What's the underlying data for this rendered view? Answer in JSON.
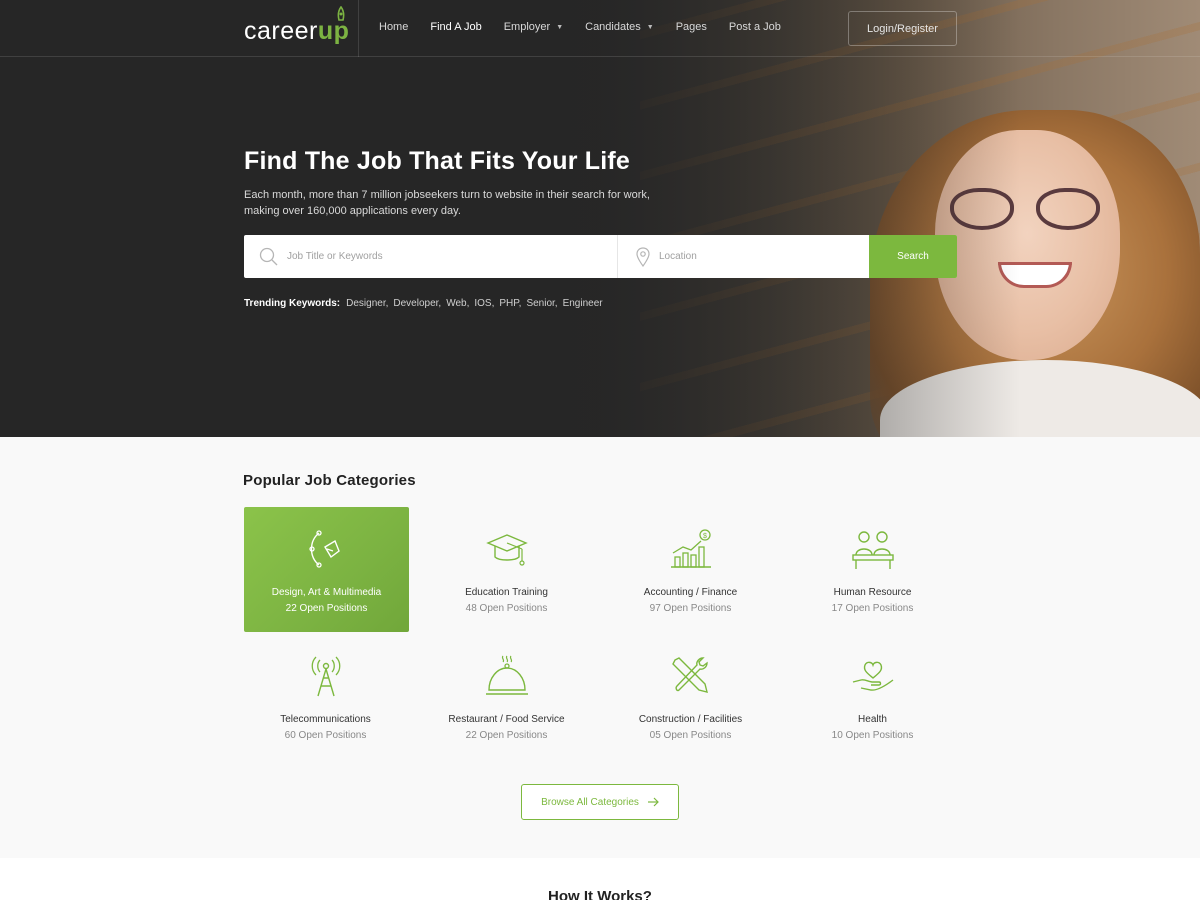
{
  "header": {
    "logo_text": "career",
    "logo_accent": "up",
    "nav": [
      {
        "label": "Home"
      },
      {
        "label": "Find A Job"
      },
      {
        "label": "Employer"
      },
      {
        "label": "Candidates"
      },
      {
        "label": "Pages"
      },
      {
        "label": "Post a Job"
      }
    ],
    "login_label": "Login/Register"
  },
  "hero": {
    "title": "Find The Job That Fits Your Life",
    "subtitle": "Each month, more than 7 million jobseekers turn to website in their search for work, making over 160,000 applications every day.",
    "search": {
      "keyword_placeholder": "Job Title or Keywords",
      "location_placeholder": "Location",
      "button_label": "Search"
    },
    "trending_label": "Trending Keywords:",
    "trending": [
      "Designer,",
      "Developer,",
      "Web,",
      "IOS,",
      "PHP,",
      "Senior,",
      "Engineer"
    ]
  },
  "categories": {
    "title": "Popular Job Categories",
    "items": [
      {
        "name": "Design, Art & Multimedia",
        "count": "22 Open Positions",
        "icon": "pen-tool-icon"
      },
      {
        "name": "Education Training",
        "count": "48 Open Positions",
        "icon": "graduation-cap-icon"
      },
      {
        "name": "Accounting / Finance",
        "count": "97 Open Positions",
        "icon": "finance-chart-icon"
      },
      {
        "name": "Human Resource",
        "count": "17 Open Positions",
        "icon": "people-desk-icon"
      },
      {
        "name": "Telecommunications",
        "count": "60 Open Positions",
        "icon": "antenna-tower-icon"
      },
      {
        "name": "Restaurant / Food Service",
        "count": "22 Open Positions",
        "icon": "food-cloche-icon"
      },
      {
        "name": "Construction / Facilities",
        "count": "05 Open Positions",
        "icon": "tools-icon"
      },
      {
        "name": "Health",
        "count": "10 Open Positions",
        "icon": "heart-hand-icon"
      }
    ],
    "browse_label": "Browse All Categories"
  },
  "how_it_works": {
    "title": "How It Works?"
  },
  "colors": {
    "accent": "#7cb83e",
    "hero_dark": "#262626"
  }
}
